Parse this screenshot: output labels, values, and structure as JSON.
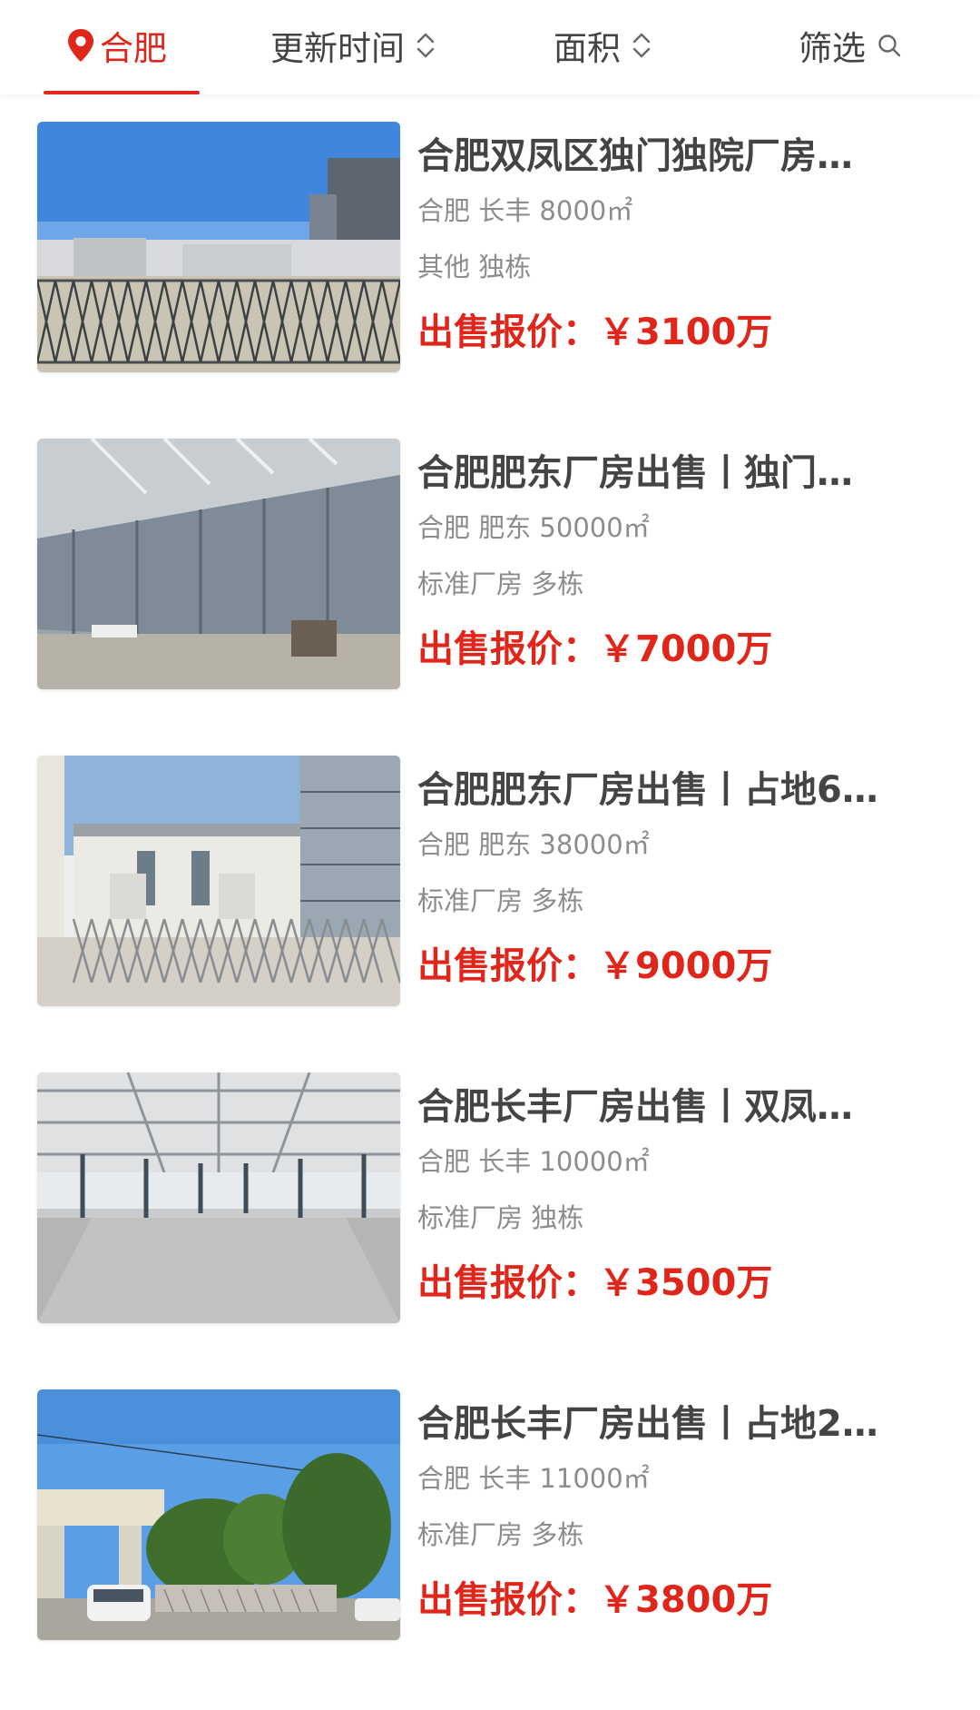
{
  "header": {
    "city": "合肥",
    "sort_time": "更新时间",
    "sort_area": "面积",
    "filter": "筛选",
    "accent_color": "#e0261a",
    "icons": {
      "location": "location-pin-icon",
      "sort": "sort-updown-icon",
      "search": "search-icon"
    }
  },
  "listings": [
    {
      "title": "合肥双凤区独门独院厂房…",
      "meta": "合肥 长丰 8000㎡",
      "tags": "其他 独栋",
      "price": "出售报价：￥3100万"
    },
    {
      "title": "合肥肥东厂房出售丨独门…",
      "meta": "合肥 肥东 50000㎡",
      "tags": "标准厂房 多栋",
      "price": "出售报价：￥7000万"
    },
    {
      "title": "合肥肥东厂房出售丨占地6…",
      "meta": "合肥 肥东 38000㎡",
      "tags": "标准厂房 多栋",
      "price": "出售报价：￥9000万"
    },
    {
      "title": "合肥长丰厂房出售丨双凤…",
      "meta": "合肥 长丰 10000㎡",
      "tags": "标准厂房 独栋",
      "price": "出售报价：￥3500万"
    },
    {
      "title": "合肥长丰厂房出售丨占地2…",
      "meta": "合肥 长丰 11000㎡",
      "tags": "标准厂房 多栋",
      "price": "出售报价：￥3800万"
    }
  ]
}
